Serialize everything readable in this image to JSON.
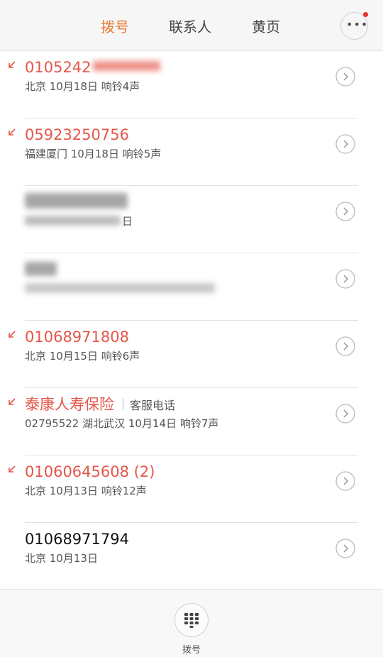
{
  "tabs": [
    {
      "label": "拨号",
      "active": true
    },
    {
      "label": "联系人",
      "active": false
    },
    {
      "label": "黄页",
      "active": false
    }
  ],
  "more": {
    "icon": "more-dots-icon",
    "has_badge": true
  },
  "calls": [
    {
      "name": "0105242",
      "tag": "",
      "detail": "北京  10月18日  响铃4声",
      "missed": true
    },
    {
      "name": "05923250756",
      "tag": "",
      "detail": "福建厦门  10月18日  响铃5声",
      "missed": true
    },
    {
      "name": "",
      "tag": "",
      "detail": "日",
      "missed": false
    },
    {
      "name": "",
      "tag": "",
      "detail": "",
      "missed": false
    },
    {
      "name": "01068971808",
      "tag": "",
      "detail": "北京  10月15日  响铃6声",
      "missed": true
    },
    {
      "name": "泰康人寿保险",
      "tag": "客服电话",
      "detail": "02795522  湖北武汉  10月14日  响铃7声",
      "missed": true
    },
    {
      "name": "01060645608 (2)",
      "tag": "",
      "detail": "北京  10月13日  响铃12声",
      "missed": true
    },
    {
      "name": "01068971794",
      "tag": "",
      "detail": "北京  10月13日",
      "missed": false
    }
  ],
  "bottom": {
    "dial_label": "拨号"
  },
  "colors": {
    "accent": "#e97a2c",
    "missed": "#e5574a",
    "badge": "#e8322a"
  }
}
